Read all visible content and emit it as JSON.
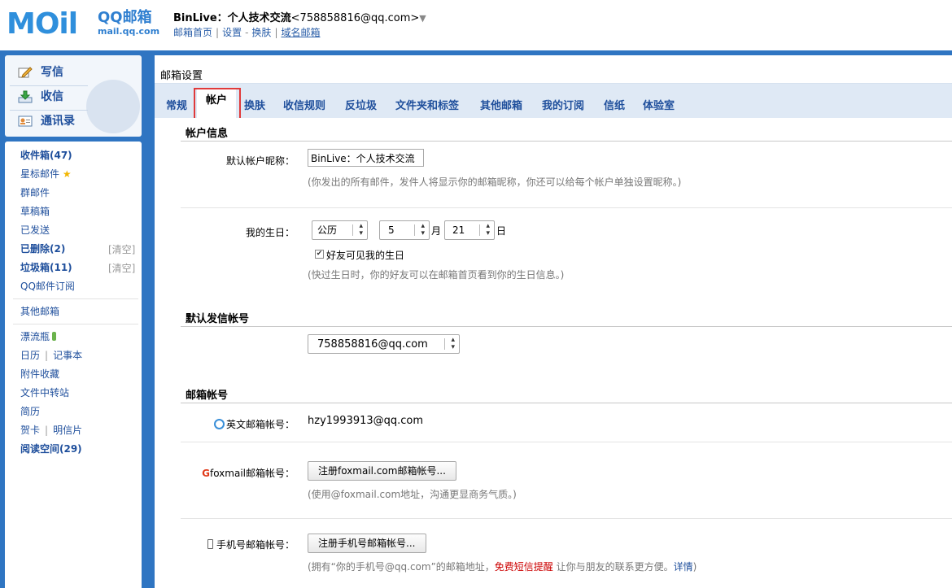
{
  "header": {
    "logo_text": "MOil",
    "logo_title": "QQ邮箱",
    "logo_sub": "mail.qq.com",
    "user_name": "BinLive：个人技术交流",
    "user_email": "<758858816@qq.com>",
    "links": [
      "邮箱首页",
      "设置",
      "换肤",
      "域名邮箱"
    ]
  },
  "sidebar": {
    "actions": [
      "写信",
      "收信",
      "通讯录"
    ],
    "items": [
      {
        "label": "收件箱(47)"
      },
      {
        "label": "星标邮件"
      },
      {
        "label": "群邮件"
      },
      {
        "label": "草稿箱"
      },
      {
        "label": "已发送"
      },
      {
        "label": "已删除(2)",
        "action": "[清空]"
      },
      {
        "label": "垃圾箱(11)",
        "action": "[清空]"
      },
      {
        "label": "QQ邮件订阅"
      },
      {
        "label": "其他邮箱"
      },
      {
        "label": "漂流瓶"
      },
      {
        "label": "日历",
        "extra": "记事本"
      },
      {
        "label": "附件收藏"
      },
      {
        "label": "文件中转站"
      },
      {
        "label": "简历"
      },
      {
        "label": "贺卡",
        "extra": "明信片"
      },
      {
        "label": "阅读空间(29)"
      }
    ]
  },
  "main": {
    "title": "邮箱设置",
    "tabs": [
      "常规",
      "帐户",
      "换肤",
      "收信规则",
      "反垃圾",
      "文件夹和标签",
      "其他邮箱",
      "我的订阅",
      "信纸",
      "体验室"
    ],
    "active_tab": "帐户"
  },
  "account": {
    "section_title": "帐户信息",
    "nickname_label": "默认帐户昵称：",
    "nickname_value": "BinLive：个人技术交流",
    "nickname_hint": "(你发出的所有邮件，发件人将显示你的邮箱昵称，你还可以给每个帐户单独设置昵称。)",
    "birthday_label": "我的生日：",
    "calendar_value": "公历",
    "month_value": "5",
    "month_unit": "月",
    "day_value": "21",
    "day_unit": "日",
    "birthday_visible_label": "好友可见我的生日",
    "birthday_visible_checked": true,
    "birthday_hint": "(快过生日时，你的好友可以在邮箱首页看到你的生日信息。)"
  },
  "sender": {
    "section_title": "默认发信帐号",
    "selected": "758858816@qq.com"
  },
  "mailbox": {
    "section_title": "邮箱帐号",
    "english_label": "英文邮箱帐号：",
    "english_value": "hzy1993913@qq.com",
    "foxmail_label": "foxmail邮箱帐号：",
    "foxmail_button": "注册foxmail.com邮箱帐号...",
    "foxmail_hint": "(使用@foxmail.com地址，沟通更显商务气质。)",
    "phone_label": "手机号邮箱帐号：",
    "phone_button": "注册手机号邮箱帐号...",
    "phone_hint_a": "(拥有“你的手机号@qq.com”的邮箱地址，",
    "phone_hint_red": "免费短信提醒",
    "phone_hint_b": " 让你与朋友的联系更方便。",
    "phone_hint_link": "详情",
    "phone_hint_end": ")"
  },
  "colors": {
    "frame_blue": "#2f75c2",
    "link_blue": "#1f4f9c",
    "tab_bar": "#dfe9f5",
    "highlight_red": "#e03a3a"
  }
}
